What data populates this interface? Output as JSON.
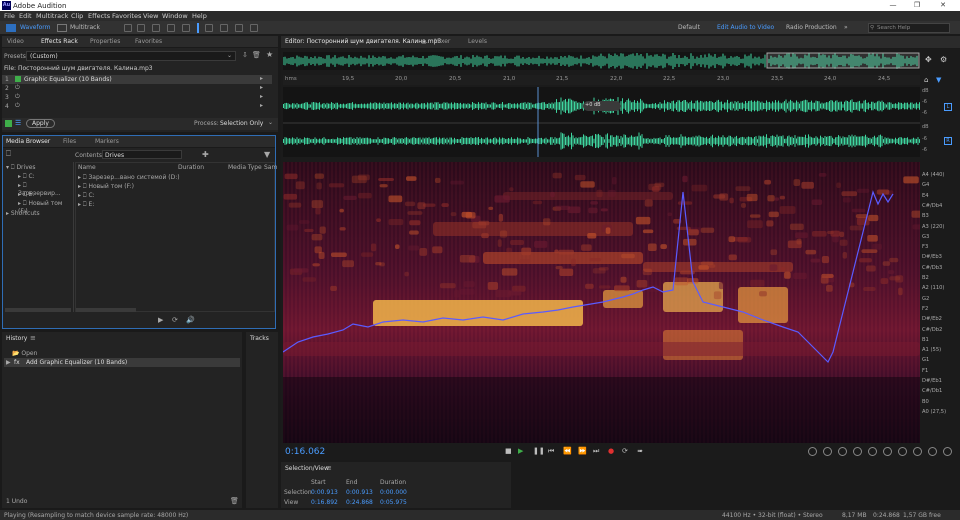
{
  "app": {
    "title": "Adobe Audition",
    "icon_text": "Au"
  },
  "menu": [
    "File",
    "Edit",
    "Multitrack",
    "Clip",
    "Effects",
    "Favorites",
    "View",
    "Window",
    "Help"
  ],
  "toolbar": {
    "waveform": "Waveform",
    "multitrack": "Multitrack",
    "workspaces": [
      "Default",
      "Edit Audio to Video",
      "Radio Production"
    ],
    "search_placeholder": "Search Help"
  },
  "left_tabs": [
    "Video",
    "Effects Rack",
    "Properties",
    "Favorites"
  ],
  "effects": {
    "presets_label": "Presets:",
    "preset_value": "(Custom)",
    "file_label": "File: Посторонний шум двигателя. Калина.mp3",
    "slots": [
      {
        "num": "1",
        "name": "Graphic Equalizer (10 Bands)"
      },
      {
        "num": "2",
        "name": ""
      },
      {
        "num": "3",
        "name": ""
      },
      {
        "num": "4",
        "name": ""
      }
    ],
    "apply": "Apply",
    "process_label": "Process:",
    "process_value": "Selection Only"
  },
  "media_tabs": [
    "Media Browser",
    "Files",
    "Markers"
  ],
  "media": {
    "contents_label": "Contents:",
    "contents_value": "Drives",
    "tree": [
      "Drives",
      "C:",
      "Зарезервир...",
      "E:",
      "Новый том (F:)",
      "Shortcuts"
    ],
    "cols": [
      "Name",
      "Duration",
      "Media Type",
      "Sam"
    ],
    "rows": [
      "Зарезер...вано системой (D:)",
      "Новый том (F:)",
      "C:",
      "E:"
    ]
  },
  "history": {
    "title": "History",
    "items": [
      "Open",
      "Add Graphic Equalizer (10 Bands)"
    ],
    "undo": "1 Undo",
    "tracks": "Tracks"
  },
  "editor": {
    "tabs": [
      "Editor: Посторонний шум двигателя. Калина.mp3",
      "Mixer",
      "Levels"
    ],
    "ruler": [
      "hms",
      "19,5",
      "20,0",
      "20,5",
      "21,0",
      "21,5",
      "22,0",
      "22,5",
      "23,0",
      "23,5",
      "24,0",
      "24,5",
      "(clip)"
    ],
    "db_labels": [
      "dB",
      "-6",
      "-6",
      "dB",
      "-6",
      "-6"
    ],
    "channels": [
      "L",
      "R"
    ],
    "clip_label": "+0 dB",
    "notes": [
      "A4 (440)",
      "G4",
      "E4",
      "C#/Db4",
      "B3",
      "A3 (220)",
      "G3",
      "F3",
      "D#/Eb3",
      "C#/Db3",
      "B2",
      "A2 (110)",
      "G2",
      "F2",
      "D#/Eb2",
      "C#/Db2",
      "B1",
      "A1 (55)",
      "G1",
      "F1",
      "D#/Eb1",
      "C#/Db1",
      "B0",
      "A0 (27,5)"
    ],
    "time": "0:16.062"
  },
  "selection": {
    "title": "Selection/View",
    "headers": [
      "Start",
      "End",
      "Duration"
    ],
    "rows": [
      {
        "label": "Selection",
        "start": "0:00.913",
        "end": "0:00.913",
        "dur": "0:00.000"
      },
      {
        "label": "View",
        "start": "0:16.892",
        "end": "0:24.868",
        "dur": "0:05.975"
      }
    ]
  },
  "status": {
    "left": "Playing (Resampling to match device sample rate: 48000 Hz)",
    "info": "44100 Hz • 32-bit (float) • Stereo",
    "size": "8,17 MB",
    "len": "0:24.868",
    "free": "1,57 GB free"
  },
  "colors": {
    "accent": "#4a9cff",
    "wave": "#3fd6a0",
    "pitch": "#5b5bff"
  }
}
